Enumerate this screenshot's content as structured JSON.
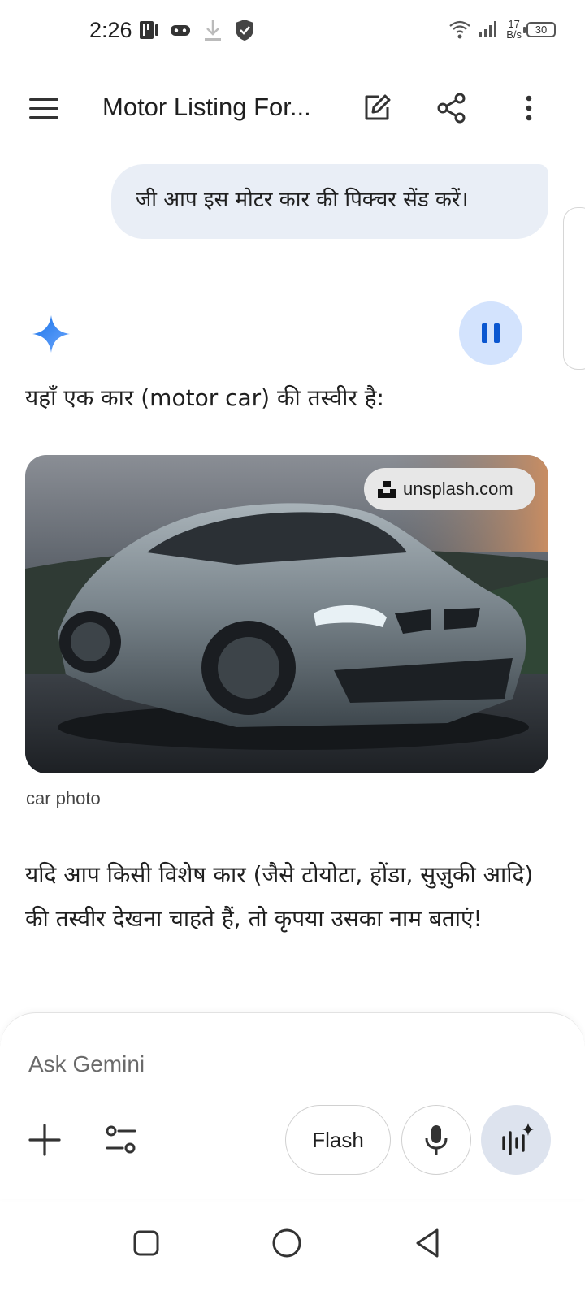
{
  "status_bar": {
    "time": "2:26",
    "net_speed_value": "17",
    "net_speed_unit": "B/s",
    "battery": "30"
  },
  "app_bar": {
    "title": "Motor Listing For..."
  },
  "conversation": {
    "user_message": "जी आप इस मोटर कार की पिक्चर सेंड करें।",
    "intro_text": "यहाँ एक कार (motor car) की तस्वीर है:",
    "image_source": "unsplash.com",
    "image_caption": "car photo",
    "response_text": "यदि आप किसी विशेष कार (जैसे टोयोटा, होंडा, सुज़ुकी आदि) की तस्वीर देखना चाहते हैं, तो कृपया उसका नाम बताएं!"
  },
  "input": {
    "placeholder": "Ask Gemini",
    "model_label": "Flash"
  },
  "colors": {
    "user_bubble": "#e9eef6",
    "pause_bg": "#d3e3fd",
    "accent_blue": "#0b57d0",
    "gemini_star": "#4285f4"
  },
  "icons": [
    "menu-icon",
    "edit-icon",
    "share-icon",
    "more-vert-icon",
    "gemini-star-icon",
    "pause-icon",
    "plus-icon",
    "tools-icon",
    "mic-icon",
    "live-icon",
    "nav-recents-icon",
    "nav-home-icon",
    "nav-back-icon"
  ]
}
